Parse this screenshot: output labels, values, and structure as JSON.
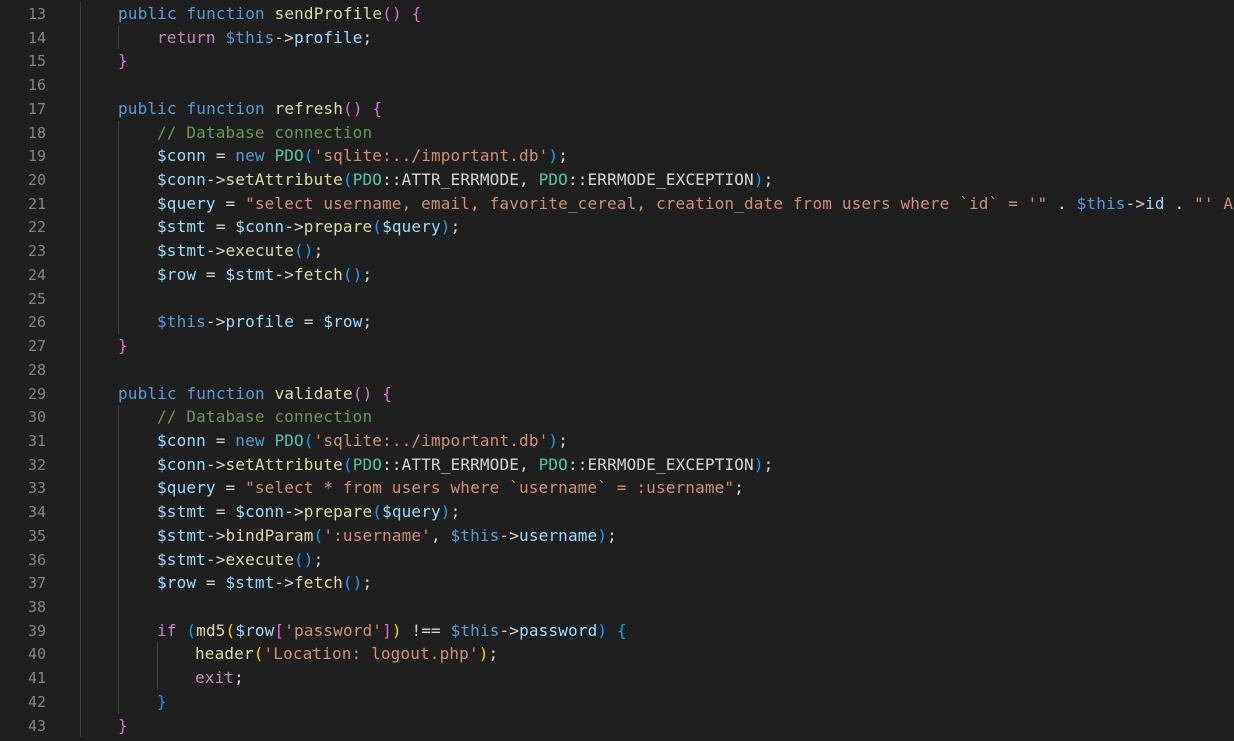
{
  "editor": {
    "language": "php",
    "theme_colors": {
      "background": "#1f1f1f",
      "line_number": "#858585",
      "keyword": "#569cd6",
      "function": "#dcdcaa",
      "variable": "#9cdcfe",
      "string": "#ce9178",
      "comment": "#6a9955",
      "class": "#4ec9b0"
    },
    "line_numbers": [
      "13",
      "14",
      "15",
      "16",
      "17",
      "18",
      "19",
      "20",
      "21",
      "22",
      "23",
      "24",
      "25",
      "26",
      "27",
      "28",
      "29",
      "30",
      "31",
      "32",
      "33",
      "34",
      "35",
      "36",
      "37",
      "38",
      "39",
      "40",
      "41",
      "42",
      "43"
    ],
    "lines": [
      [
        [
          "kw",
          "public"
        ],
        [
          "op",
          " "
        ],
        [
          "kw",
          "function"
        ],
        [
          "op",
          " "
        ],
        [
          "fn",
          "sendProfile"
        ],
        [
          "p2",
          "()"
        ],
        [
          "op",
          " "
        ],
        [
          "p2",
          "{"
        ]
      ],
      [
        [
          "ctl",
          "return"
        ],
        [
          "op",
          " "
        ],
        [
          "this",
          "$this"
        ],
        [
          "op",
          "->"
        ],
        [
          "var",
          "profile"
        ],
        [
          "op",
          ";"
        ]
      ],
      [
        [
          "p2",
          "}"
        ]
      ],
      [],
      [
        [
          "kw",
          "public"
        ],
        [
          "op",
          " "
        ],
        [
          "kw",
          "function"
        ],
        [
          "op",
          " "
        ],
        [
          "fn",
          "refresh"
        ],
        [
          "p2",
          "()"
        ],
        [
          "op",
          " "
        ],
        [
          "p2",
          "{"
        ]
      ],
      [
        [
          "cmt",
          "// Database connection"
        ]
      ],
      [
        [
          "var",
          "$conn"
        ],
        [
          "op",
          " = "
        ],
        [
          "kw",
          "new"
        ],
        [
          "op",
          " "
        ],
        [
          "cls",
          "PDO"
        ],
        [
          "p3",
          "("
        ],
        [
          "str",
          "'sqlite:../important.db'"
        ],
        [
          "p3",
          ")"
        ],
        [
          "op",
          ";"
        ]
      ],
      [
        [
          "var",
          "$conn"
        ],
        [
          "op",
          "->"
        ],
        [
          "fn",
          "setAttribute"
        ],
        [
          "p3",
          "("
        ],
        [
          "cls",
          "PDO"
        ],
        [
          "op",
          "::ATTR_ERRMODE, "
        ],
        [
          "cls",
          "PDO"
        ],
        [
          "op",
          "::ERRMODE_EXCEPTION"
        ],
        [
          "p3",
          ")"
        ],
        [
          "op",
          ";"
        ]
      ],
      [
        [
          "var",
          "$query"
        ],
        [
          "op",
          " = "
        ],
        [
          "str",
          "\"select username, email, favorite_cereal, creation_date from users where `id` = '\""
        ],
        [
          "op",
          " . "
        ],
        [
          "this",
          "$this"
        ],
        [
          "op",
          "->"
        ],
        [
          "var",
          "id"
        ],
        [
          "op",
          " . "
        ],
        [
          "str",
          "\"' AND"
        ]
      ],
      [
        [
          "var",
          "$stmt"
        ],
        [
          "op",
          " = "
        ],
        [
          "var",
          "$conn"
        ],
        [
          "op",
          "->"
        ],
        [
          "fn",
          "prepare"
        ],
        [
          "p3",
          "("
        ],
        [
          "var",
          "$query"
        ],
        [
          "p3",
          ")"
        ],
        [
          "op",
          ";"
        ]
      ],
      [
        [
          "var",
          "$stmt"
        ],
        [
          "op",
          "->"
        ],
        [
          "fn",
          "execute"
        ],
        [
          "p3",
          "()"
        ],
        [
          "op",
          ";"
        ]
      ],
      [
        [
          "var",
          "$row"
        ],
        [
          "op",
          " = "
        ],
        [
          "var",
          "$stmt"
        ],
        [
          "op",
          "->"
        ],
        [
          "fn",
          "fetch"
        ],
        [
          "p3",
          "()"
        ],
        [
          "op",
          ";"
        ]
      ],
      [],
      [
        [
          "this",
          "$this"
        ],
        [
          "op",
          "->"
        ],
        [
          "var",
          "profile"
        ],
        [
          "op",
          " = "
        ],
        [
          "var",
          "$row"
        ],
        [
          "op",
          ";"
        ]
      ],
      [
        [
          "p2",
          "}"
        ]
      ],
      [],
      [
        [
          "kw",
          "public"
        ],
        [
          "op",
          " "
        ],
        [
          "kw",
          "function"
        ],
        [
          "op",
          " "
        ],
        [
          "fn",
          "validate"
        ],
        [
          "p2",
          "()"
        ],
        [
          "op",
          " "
        ],
        [
          "p2",
          "{"
        ]
      ],
      [
        [
          "cmt",
          "// Database connection"
        ]
      ],
      [
        [
          "var",
          "$conn"
        ],
        [
          "op",
          " = "
        ],
        [
          "kw",
          "new"
        ],
        [
          "op",
          " "
        ],
        [
          "cls",
          "PDO"
        ],
        [
          "p3",
          "("
        ],
        [
          "str",
          "'sqlite:../important.db'"
        ],
        [
          "p3",
          ")"
        ],
        [
          "op",
          ";"
        ]
      ],
      [
        [
          "var",
          "$conn"
        ],
        [
          "op",
          "->"
        ],
        [
          "fn",
          "setAttribute"
        ],
        [
          "p3",
          "("
        ],
        [
          "cls",
          "PDO"
        ],
        [
          "op",
          "::ATTR_ERRMODE, "
        ],
        [
          "cls",
          "PDO"
        ],
        [
          "op",
          "::ERRMODE_EXCEPTION"
        ],
        [
          "p3",
          ")"
        ],
        [
          "op",
          ";"
        ]
      ],
      [
        [
          "var",
          "$query"
        ],
        [
          "op",
          " = "
        ],
        [
          "str",
          "\"select * from users where `username` = :username\""
        ],
        [
          "op",
          ";"
        ]
      ],
      [
        [
          "var",
          "$stmt"
        ],
        [
          "op",
          " = "
        ],
        [
          "var",
          "$conn"
        ],
        [
          "op",
          "->"
        ],
        [
          "fn",
          "prepare"
        ],
        [
          "p3",
          "("
        ],
        [
          "var",
          "$query"
        ],
        [
          "p3",
          ")"
        ],
        [
          "op",
          ";"
        ]
      ],
      [
        [
          "var",
          "$stmt"
        ],
        [
          "op",
          "->"
        ],
        [
          "fn",
          "bindParam"
        ],
        [
          "p3",
          "("
        ],
        [
          "str",
          "':username'"
        ],
        [
          "op",
          ", "
        ],
        [
          "this",
          "$this"
        ],
        [
          "op",
          "->"
        ],
        [
          "var",
          "username"
        ],
        [
          "p3",
          ")"
        ],
        [
          "op",
          ";"
        ]
      ],
      [
        [
          "var",
          "$stmt"
        ],
        [
          "op",
          "->"
        ],
        [
          "fn",
          "execute"
        ],
        [
          "p3",
          "()"
        ],
        [
          "op",
          ";"
        ]
      ],
      [
        [
          "var",
          "$row"
        ],
        [
          "op",
          " = "
        ],
        [
          "var",
          "$stmt"
        ],
        [
          "op",
          "->"
        ],
        [
          "fn",
          "fetch"
        ],
        [
          "p3",
          "()"
        ],
        [
          "op",
          ";"
        ]
      ],
      [],
      [
        [
          "ctl",
          "if"
        ],
        [
          "op",
          " "
        ],
        [
          "p3",
          "("
        ],
        [
          "fn",
          "md5"
        ],
        [
          "p1",
          "("
        ],
        [
          "var",
          "$row"
        ],
        [
          "p2",
          "["
        ],
        [
          "str",
          "'password'"
        ],
        [
          "p2",
          "]"
        ],
        [
          "p1",
          ")"
        ],
        [
          "op",
          " !== "
        ],
        [
          "this",
          "$this"
        ],
        [
          "op",
          "->"
        ],
        [
          "var",
          "password"
        ],
        [
          "p3",
          ")"
        ],
        [
          "op",
          " "
        ],
        [
          "p3",
          "{"
        ]
      ],
      [
        [
          "fn",
          "header"
        ],
        [
          "p1",
          "("
        ],
        [
          "str",
          "'Location: logout.php'"
        ],
        [
          "p1",
          ")"
        ],
        [
          "op",
          ";"
        ]
      ],
      [
        [
          "ctl",
          "exit"
        ],
        [
          "op",
          ";"
        ]
      ],
      [
        [
          "p3",
          "}"
        ]
      ],
      [
        [
          "p2",
          "}"
        ]
      ]
    ]
  }
}
